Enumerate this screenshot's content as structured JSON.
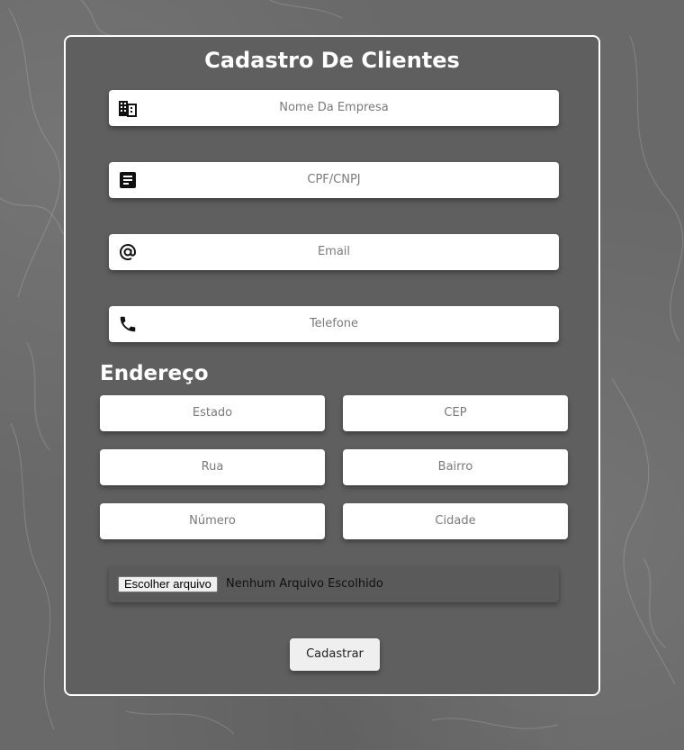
{
  "form": {
    "title": "Cadastro De Clientes",
    "fields": [
      {
        "placeholder": "Nome Da Empresa",
        "icon": "building-icon"
      },
      {
        "placeholder": "CPF/CNPJ",
        "icon": "document-icon"
      },
      {
        "placeholder": "Email",
        "icon": "at-sign-icon"
      },
      {
        "placeholder": "Telefone",
        "icon": "phone-icon"
      }
    ],
    "address": {
      "title": "Endereço",
      "estado": "Estado",
      "cep": "CEP",
      "rua": "Rua",
      "bairro": "Bairro",
      "numero": "Número",
      "cidade": "Cidade"
    },
    "file": {
      "button_label": "Escolher arquivo",
      "status": "Nenhum Arquivo Escolhido"
    },
    "submit_label": "Cadastrar"
  },
  "colors": {
    "background": "#696969",
    "card": "#5f5f5f",
    "border": "#ffffff",
    "input": "#ffffff",
    "placeholder": "#7a7a7a"
  }
}
